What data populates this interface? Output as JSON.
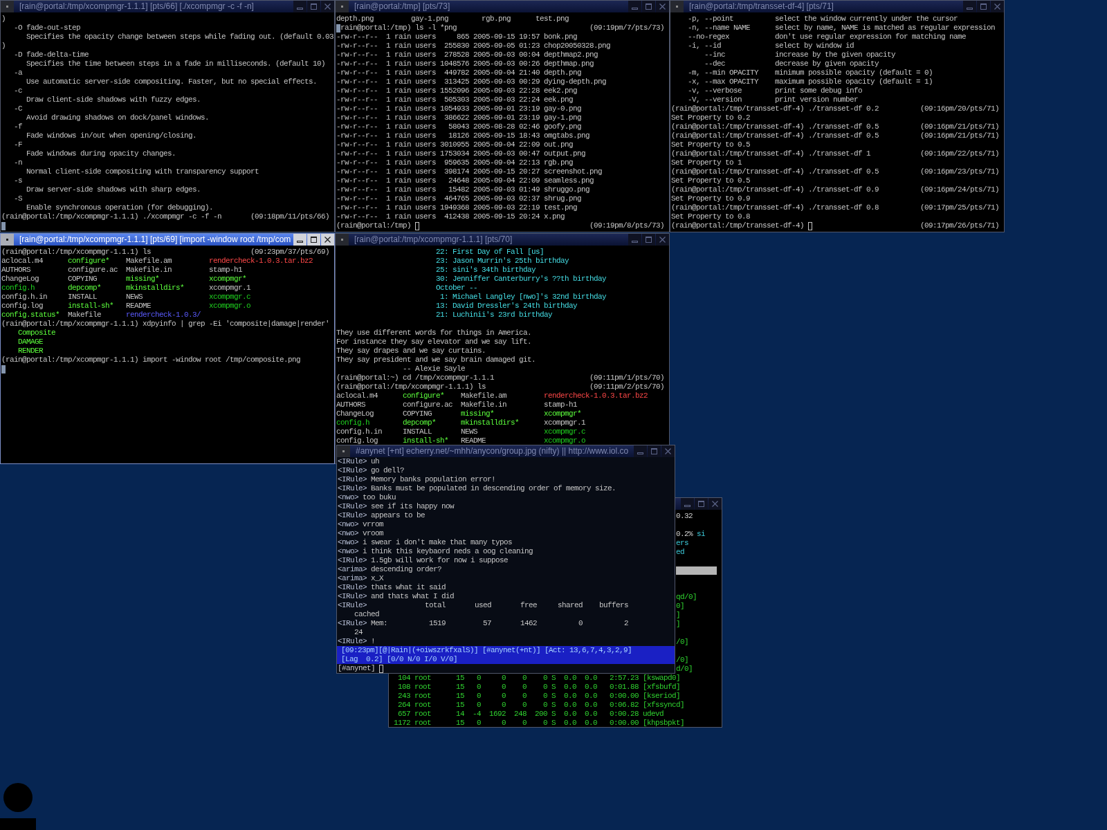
{
  "windows": [
    {
      "kind": "terminal",
      "title": "[rain@portal:/tmp/xcompmgr-1.1.1] [pts/66] [./xcompmgr -c -f -n]",
      "focused": false,
      "lines": [
        {
          "kind": "text",
          "text": ")"
        },
        {
          "kind": "option",
          "flag": "-O fade-out-step",
          "description": "Specifies the opacity change between steps while fading out. (default 0.03"
        },
        {
          "kind": "text",
          "text": ")"
        },
        {
          "kind": "option",
          "flag": "-D fade-delta-time",
          "description": "Specifies the time between steps in a fade in milliseconds. (default 10)"
        },
        {
          "kind": "option",
          "flag": "-a",
          "description": "Use automatic server-side compositing. Faster, but no special effects."
        },
        {
          "kind": "option",
          "flag": "-c",
          "description": "Draw client-side shadows with fuzzy edges."
        },
        {
          "kind": "option",
          "flag": "-C",
          "description": "Avoid drawing shadows on dock/panel windows."
        },
        {
          "kind": "option",
          "flag": "-f",
          "description": "Fade windows in/out when opening/closing."
        },
        {
          "kind": "option",
          "flag": "-F",
          "description": "Fade windows during opacity changes."
        },
        {
          "kind": "option",
          "flag": "-n",
          "description": "Normal client-side compositing with transparency support"
        },
        {
          "kind": "option",
          "flag": "-s",
          "description": "Draw server-side shadows with sharp edges."
        },
        {
          "kind": "option",
          "flag": "-S",
          "description": "Enable synchronous operation (for debugging)."
        },
        {
          "kind": "prompt",
          "text": "(rain@portal:/tmp/xcompmgr-1.1.1) ./xcompmgr -c -f -n",
          "stamp": "(09:18pm/11/pts/66)",
          "block_cursor": false,
          "cursor": false
        },
        {
          "kind": "cursor"
        }
      ]
    },
    {
      "kind": "terminal",
      "title": "[rain@portal:/tmp] [pts/73]",
      "focused": false,
      "lines": [
        {
          "kind": "listing",
          "rows": [
            [
              {
                "name": "depth.png",
                "kind": "file"
              },
              {
                "name": "gay-1.png",
                "kind": "file"
              },
              {
                "name": "rgb.png",
                "kind": "file"
              },
              {
                "name": "test.png",
                "kind": "file"
              }
            ]
          ]
        },
        {
          "kind": "prompt",
          "text": "rain@portal:/tmp) ls -l *png",
          "stamp": "(09:19pm/7/pts/73)",
          "block_cursor": true,
          "cursor": false
        },
        {
          "kind": "long_listing",
          "rows": [
            {
              "perms": "-rw-r--r--",
              "links": "1",
              "owner": "rain",
              "group": "users",
              "size": "865",
              "date": "2005-09-15",
              "time": "19:57",
              "name": "bonk.png"
            },
            {
              "perms": "-rw-r--r--",
              "links": "1",
              "owner": "rain",
              "group": "users",
              "size": "255830",
              "date": "2005-09-05",
              "time": "01:23",
              "name": "chop20050328.png"
            },
            {
              "perms": "-rw-r--r--",
              "links": "1",
              "owner": "rain",
              "group": "users",
              "size": "278528",
              "date": "2005-09-03",
              "time": "00:04",
              "name": "depthmap2.png"
            },
            {
              "perms": "-rw-r--r--",
              "links": "1",
              "owner": "rain",
              "group": "users",
              "size": "1048576",
              "date": "2005-09-03",
              "time": "00:26",
              "name": "depthmap.png"
            },
            {
              "perms": "-rw-r--r--",
              "links": "1",
              "owner": "rain",
              "group": "users",
              "size": "449782",
              "date": "2005-09-04",
              "time": "21:40",
              "name": "depth.png"
            },
            {
              "perms": "-rw-r--r--",
              "links": "1",
              "owner": "rain",
              "group": "users",
              "size": "313425",
              "date": "2005-09-03",
              "time": "00:29",
              "name": "dying-depth.png"
            },
            {
              "perms": "-rw-r--r--",
              "links": "1",
              "owner": "rain",
              "group": "users",
              "size": "1552096",
              "date": "2005-09-03",
              "time": "22:28",
              "name": "eek2.png"
            },
            {
              "perms": "-rw-r--r--",
              "links": "1",
              "owner": "rain",
              "group": "users",
              "size": "505303",
              "date": "2005-09-03",
              "time": "22:24",
              "name": "eek.png"
            },
            {
              "perms": "-rw-r--r--",
              "links": "1",
              "owner": "rain",
              "group": "users",
              "size": "1054933",
              "date": "2005-09-01",
              "time": "23:19",
              "name": "gay-0.png"
            },
            {
              "perms": "-rw-r--r--",
              "links": "1",
              "owner": "rain",
              "group": "users",
              "size": "386622",
              "date": "2005-09-01",
              "time": "23:19",
              "name": "gay-1.png"
            },
            {
              "perms": "-rw-r--r--",
              "links": "1",
              "owner": "rain",
              "group": "users",
              "size": "58043",
              "date": "2005-08-28",
              "time": "02:46",
              "name": "goofy.png"
            },
            {
              "perms": "-rw-r--r--",
              "links": "1",
              "owner": "rain",
              "group": "users",
              "size": "18126",
              "date": "2005-09-15",
              "time": "18:43",
              "name": "omgtabs.png"
            },
            {
              "perms": "-rw-r--r--",
              "links": "1",
              "owner": "rain",
              "group": "users",
              "size": "3010955",
              "date": "2005-09-04",
              "time": "22:09",
              "name": "out.png"
            },
            {
              "perms": "-rw-r--r--",
              "links": "1",
              "owner": "rain",
              "group": "users",
              "size": "1753034",
              "date": "2005-09-03",
              "time": "00:47",
              "name": "output.png"
            },
            {
              "perms": "-rw-r--r--",
              "links": "1",
              "owner": "rain",
              "group": "users",
              "size": "959635",
              "date": "2005-09-04",
              "time": "22:13",
              "name": "rgb.png"
            },
            {
              "perms": "-rw-r--r--",
              "links": "1",
              "owner": "rain",
              "group": "users",
              "size": "398174",
              "date": "2005-09-15",
              "time": "20:27",
              "name": "screenshot.png"
            },
            {
              "perms": "-rw-r--r--",
              "links": "1",
              "owner": "rain",
              "group": "users",
              "size": "24648",
              "date": "2005-09-04",
              "time": "22:09",
              "name": "seamless.png"
            },
            {
              "perms": "-rw-r--r--",
              "links": "1",
              "owner": "rain",
              "group": "users",
              "size": "15482",
              "date": "2005-09-03",
              "time": "01:49",
              "name": "shruggo.png"
            },
            {
              "perms": "-rw-r--r--",
              "links": "1",
              "owner": "rain",
              "group": "users",
              "size": "464765",
              "date": "2005-09-03",
              "time": "02:37",
              "name": "shrug.png"
            },
            {
              "perms": "-rw-r--r--",
              "links": "1",
              "owner": "rain",
              "group": "users",
              "size": "1949368",
              "date": "2005-09-03",
              "time": "22:19",
              "name": "test.png"
            },
            {
              "perms": "-rw-r--r--",
              "links": "1",
              "owner": "rain",
              "group": "users",
              "size": "412438",
              "date": "2005-09-15",
              "time": "20:24",
              "name": "x.png"
            }
          ]
        },
        {
          "kind": "prompt",
          "text": "(rain@portal:/tmp)",
          "stamp": "(09:19pm/8/pts/73)",
          "block_cursor": false,
          "cursor": true
        }
      ]
    },
    {
      "kind": "terminal",
      "title": "[rain@portal:/tmp/transset-df-4] [pts/71]",
      "focused": false,
      "lines": [
        {
          "kind": "option_row",
          "flag": "-p, --point",
          "description": "select the window currently under the cursor"
        },
        {
          "kind": "option_row",
          "flag": "-n, --name NAME",
          "description": "select by name, NAME is matched as regular expression"
        },
        {
          "kind": "option_row",
          "flag": "--no-regex",
          "description": "don't use regular expression for matching name"
        },
        {
          "kind": "option_row",
          "flag": "-i, --id",
          "description": "select by window id",
          "children": [
            {
              "flag": "--inc",
              "description": "increase by the given opacity"
            },
            {
              "flag": "--dec",
              "description": "decrease by given opacity"
            }
          ]
        },
        {
          "kind": "option_row",
          "flag": "-m, --min OPACITY",
          "description": "minimum possible opacity (default = 0)"
        },
        {
          "kind": "option_row",
          "flag": "-x, --max OPACITY",
          "description": "maximum possible opacity (default = 1)"
        },
        {
          "kind": "option_row",
          "flag": "-v, --verbose",
          "description": "print some debug info"
        },
        {
          "kind": "option_row",
          "flag": "-V, --version",
          "description": "print version number"
        },
        {
          "kind": "prompt",
          "text": "(rain@portal:/tmp/transset-df-4) ./transset-df 0.2",
          "stamp": "(09:16pm/20/pts/71)",
          "block_cursor": false,
          "cursor": false
        },
        {
          "kind": "text",
          "text": "Set Property to 0.2"
        },
        {
          "kind": "prompt",
          "text": "(rain@portal:/tmp/transset-df-4) ./transset-df 0.5",
          "stamp": "(09:16pm/21/pts/71)",
          "block_cursor": false,
          "cursor": false
        },
        {
          "kind": "prompt",
          "text": "(rain@portal:/tmp/transset-df-4) ./transset-df 0.5",
          "stamp": "(09:16pm/21/pts/71)",
          "block_cursor": false,
          "cursor": false
        },
        {
          "kind": "text",
          "text": "Set Property to 0.5"
        },
        {
          "kind": "prompt",
          "text": "(rain@portal:/tmp/transset-df-4) ./transset-df 1",
          "stamp": "(09:16pm/22/pts/71)",
          "block_cursor": false,
          "cursor": false
        },
        {
          "kind": "text",
          "text": "Set Property to 1"
        },
        {
          "kind": "prompt",
          "text": "(rain@portal:/tmp/transset-df-4) ./transset-df 0.5",
          "stamp": "(09:16pm/23/pts/71)",
          "block_cursor": false,
          "cursor": false
        },
        {
          "kind": "text",
          "text": "Set Property to 0.5"
        },
        {
          "kind": "prompt",
          "text": "(rain@portal:/tmp/transset-df-4) ./transset-df 0.9",
          "stamp": "(09:16pm/24/pts/71)",
          "block_cursor": false,
          "cursor": false
        },
        {
          "kind": "text",
          "text": "Set Property to 0.9"
        },
        {
          "kind": "prompt",
          "text": "(rain@portal:/tmp/transset-df-4) ./transset-df 0.8",
          "stamp": "(09:17pm/25/pts/71)",
          "block_cursor": false,
          "cursor": false
        },
        {
          "kind": "text",
          "text": "Set Property to 0.8"
        },
        {
          "kind": "prompt",
          "text": "(rain@portal:/tmp/transset-df-4)",
          "stamp": "(09:17pm/26/pts/71)",
          "block_cursor": false,
          "cursor": true
        }
      ]
    },
    {
      "kind": "terminal",
      "title": "[rain@portal:/tmp/xcompmgr-1.1.1] [pts/69] [import -window root /tmp/com",
      "focused": true,
      "lines": [
        {
          "kind": "prompt",
          "text": "(rain@portal:/tmp/xcompmgr-1.1.1) ls",
          "stamp": "(09:23pm/37/pts/69)",
          "block_cursor": false,
          "cursor": false
        },
        {
          "kind": "listing",
          "rows": [
            [
              {
                "name": "aclocal.m4",
                "kind": "file"
              },
              {
                "name": "configure*",
                "kind": "executable"
              },
              {
                "name": "Makefile.am",
                "kind": "file"
              },
              {
                "name": "rendercheck-1.0.3.tar.bz2",
                "kind": "archive"
              }
            ],
            [
              {
                "name": "AUTHORS",
                "kind": "file"
              },
              {
                "name": "configure.ac",
                "kind": "file"
              },
              {
                "name": "Makefile.in",
                "kind": "file"
              },
              {
                "name": "stamp-h1",
                "kind": "file"
              }
            ],
            [
              {
                "name": "ChangeLog",
                "kind": "file"
              },
              {
                "name": "COPYING",
                "kind": "file"
              },
              {
                "name": "missing*",
                "kind": "executable"
              },
              {
                "name": "xcompmgr*",
                "kind": "executable"
              }
            ],
            [
              {
                "name": "config.h",
                "kind": "source"
              },
              {
                "name": "depcomp*",
                "kind": "executable"
              },
              {
                "name": "mkinstalldirs*",
                "kind": "executable"
              },
              {
                "name": "xcompmgr.1",
                "kind": "file"
              }
            ],
            [
              {
                "name": "config.h.in",
                "kind": "file"
              },
              {
                "name": "INSTALL",
                "kind": "file"
              },
              {
                "name": "NEWS",
                "kind": "file"
              },
              {
                "name": "xcompmgr.c",
                "kind": "source"
              }
            ],
            [
              {
                "name": "config.log",
                "kind": "file"
              },
              {
                "name": "install-sh*",
                "kind": "executable"
              },
              {
                "name": "README",
                "kind": "file"
              },
              {
                "name": "xcompmgr.o",
                "kind": "source"
              }
            ],
            [
              {
                "name": "config.status*",
                "kind": "executable"
              },
              {
                "name": "Makefile",
                "kind": "file"
              },
              {
                "name": "rendercheck-1.0.3/",
                "kind": "directory"
              }
            ]
          ]
        },
        {
          "kind": "prompt",
          "text": "(rain@portal:/tmp/xcompmgr-1.1.1) xdpyinfo | grep -Ei 'composite|damage|render'",
          "block_cursor": false,
          "cursor": false
        },
        {
          "kind": "match",
          "text": "Composite"
        },
        {
          "kind": "match",
          "text": "DAMAGE"
        },
        {
          "kind": "match",
          "text": "RENDER"
        },
        {
          "kind": "prompt",
          "text": "(rain@portal:/tmp/xcompmgr-1.1.1) import -window root /tmp/composite.png",
          "block_cursor": false,
          "cursor": false
        },
        {
          "kind": "cursor"
        }
      ]
    },
    {
      "kind": "terminal",
      "title": "[rain@portal:/tmp/xcompmgr-1.1.1] [pts/70]",
      "focused": false,
      "lines": [
        {
          "kind": "calendar",
          "day": "22:",
          "event": "First Day of Fall [us]"
        },
        {
          "kind": "calendar",
          "day": "23:",
          "event": "Jason Murrin's 25th birthday"
        },
        {
          "kind": "calendar",
          "day": "25:",
          "event": "sini's 34th birthday"
        },
        {
          "kind": "calendar",
          "day": "30:",
          "event": "Jenniffer Canterburry's ??th birthday"
        },
        {
          "kind": "month",
          "text": "October --"
        },
        {
          "kind": "calendar",
          "day": "1:",
          "event": "Michael Langley [nwo]'s 32nd birthday"
        },
        {
          "kind": "calendar",
          "day": "13:",
          "event": "David Dressler's 24th birthday"
        },
        {
          "kind": "calendar",
          "day": "21:",
          "event": "Luchinii's 23rd birthday"
        },
        {
          "kind": "blank"
        },
        {
          "kind": "quote",
          "text": "They use different words for things in America."
        },
        {
          "kind": "quote",
          "text": "For instance they say elevator and we say lift."
        },
        {
          "kind": "quote",
          "text": "They say drapes and we say curtains."
        },
        {
          "kind": "quote",
          "text": "They say president and we say brain damaged git."
        },
        {
          "kind": "attribution",
          "text": "-- Alexie Sayle"
        },
        {
          "kind": "prompt",
          "text": "(rain@portal:~) cd /tmp/xcompmgr-1.1.1",
          "stamp": "(09:11pm/1/pts/70)",
          "block_cursor": false,
          "cursor": false
        },
        {
          "kind": "prompt",
          "text": "(rain@portal:/tmp/xcompmgr-1.1.1) ls",
          "stamp": "(09:11pm/2/pts/70)",
          "block_cursor": false,
          "cursor": false
        },
        {
          "kind": "listing",
          "rows": [
            [
              {
                "name": "aclocal.m4",
                "kind": "file"
              },
              {
                "name": "configure*",
                "kind": "executable"
              },
              {
                "name": "Makefile.am",
                "kind": "file"
              },
              {
                "name": "rendercheck-1.0.3.tar.bz2",
                "kind": "archive"
              }
            ],
            [
              {
                "name": "AUTHORS",
                "kind": "file"
              },
              {
                "name": "configure.ac",
                "kind": "file"
              },
              {
                "name": "Makefile.in",
                "kind": "file"
              },
              {
                "name": "stamp-h1",
                "kind": "file"
              }
            ],
            [
              {
                "name": "ChangeLog",
                "kind": "file"
              },
              {
                "name": "COPYING",
                "kind": "file"
              },
              {
                "name": "missing*",
                "kind": "executable"
              },
              {
                "name": "xcompmgr*",
                "kind": "executable"
              }
            ],
            [
              {
                "name": "config.h",
                "kind": "source"
              },
              {
                "name": "depcomp*",
                "kind": "executable"
              },
              {
                "name": "mkinstalldirs*",
                "kind": "executable"
              },
              {
                "name": "xcompmgr.1",
                "kind": "file"
              }
            ],
            [
              {
                "name": "config.h.in",
                "kind": "file"
              },
              {
                "name": "INSTALL",
                "kind": "file"
              },
              {
                "name": "NEWS",
                "kind": "file"
              },
              {
                "name": "xcompmgr.c",
                "kind": "source"
              }
            ],
            [
              {
                "name": "config.log",
                "kind": "file"
              },
              {
                "name": "install-sh*",
                "kind": "executable"
              },
              {
                "name": "README",
                "kind": "file"
              },
              {
                "name": "xcompmgr.o",
                "kind": "source"
              }
            ]
          ]
        }
      ]
    },
    {
      "kind": "irc",
      "title": "#anynet [+nt] echerry.net/~mhh/anycon/group.jpg (nifty) || http://www.iol.co",
      "focused": false,
      "messages": [
        {
          "kind": "message",
          "nick": "<IRule>",
          "text": "uh"
        },
        {
          "kind": "message",
          "nick": "<IRule>",
          "text": "go dell?"
        },
        {
          "kind": "message",
          "nick": "<IRule>",
          "text": "Memory banks population error!"
        },
        {
          "kind": "message",
          "nick": "<IRule>",
          "text": "Banks must be populated in descending order of memory size."
        },
        {
          "kind": "message",
          "nick": "<nwo>",
          "text": "too buku"
        },
        {
          "kind": "message",
          "nick": "<IRule>",
          "text": "see if its happy now"
        },
        {
          "kind": "message",
          "nick": "<IRule>",
          "text": "appears to be"
        },
        {
          "kind": "message",
          "nick": "<nwo>",
          "text": "vrrom"
        },
        {
          "kind": "message",
          "nick": "<nwo>",
          "text": "vroom"
        },
        {
          "kind": "message",
          "nick": "<nwo>",
          "text": "i swear i don't make that many typos"
        },
        {
          "kind": "message",
          "nick": "<nwo>",
          "text": "i think this keybaord neds a oog cleaning"
        },
        {
          "kind": "message",
          "nick": "<IRule>",
          "text": "1.5gb will work for now i suppose"
        },
        {
          "kind": "message",
          "nick": "<arima>",
          "text": "descending order?"
        },
        {
          "kind": "message",
          "nick": "<arima>",
          "text": "x_X"
        },
        {
          "kind": "message",
          "nick": "<IRule>",
          "text": "thats what it said"
        },
        {
          "kind": "message",
          "nick": "<IRule>",
          "text": "and thats what I did"
        },
        {
          "kind": "table_header",
          "nick": "<IRule>",
          "cells": [
            "total",
            "used",
            "free",
            "shared",
            "buffers"
          ],
          "overflow": "cached"
        },
        {
          "kind": "table_row",
          "nick": "<IRule>",
          "label": "Mem:",
          "cells": [
            "1519",
            "57",
            "1462",
            "0",
            "2"
          ],
          "overflow": "24"
        },
        {
          "kind": "message",
          "nick": "<IRule>",
          "text": "!"
        }
      ],
      "status_bar": {
        "lines": [
          {
            "items": [
              "[09:23pm][@|Rain|(+oiwszrkfxalS)]",
              "[#anynet(+nt)]",
              "[Act: 13,6,7,4,3,2,9]"
            ]
          },
          {
            "items": [
              "[Lag  0.2]",
              "[0/0 N/0 I/0 V/0]"
            ]
          }
        ]
      },
      "input": {
        "prompt": "[#anynet]"
      }
    },
    {
      "kind": "top",
      "focused": false,
      "lines": [
        {
          "kind": "value",
          "text": "0.32"
        },
        {
          "kind": "blank"
        },
        {
          "kind": "stat",
          "value": "0.2%",
          "label": "si"
        },
        {
          "kind": "label",
          "text": "ers"
        },
        {
          "kind": "label",
          "text": "ed"
        },
        {
          "kind": "blank"
        },
        {
          "kind": "header"
        },
        {
          "kind": "blank"
        },
        {
          "kind": "blank"
        },
        {
          "kind": "command",
          "text": "qd/0]"
        },
        {
          "kind": "command",
          "text": "0]"
        },
        {
          "kind": "command",
          "text": "]"
        },
        {
          "kind": "command",
          "text": "]"
        },
        {
          "kind": "blank"
        },
        {
          "kind": "command",
          "text": "/0]"
        },
        {
          "kind": "blank"
        },
        {
          "kind": "command",
          "text": "/0]"
        },
        {
          "kind": "command",
          "text": "d/0]"
        },
        {
          "kind": "process",
          "pid": "104",
          "user": "root",
          "pr": "15",
          "ni": "0",
          "virt": "0",
          "res": "0",
          "shr": "0",
          "state": "S",
          "cpu": "0.0",
          "mem": "0.0",
          "time": "2:57.23",
          "command": "[kswapd0]"
        },
        {
          "kind": "process",
          "pid": "108",
          "user": "root",
          "pr": "15",
          "ni": "0",
          "virt": "0",
          "res": "0",
          "shr": "0",
          "state": "S",
          "cpu": "0.0",
          "mem": "0.0",
          "time": "0:01.88",
          "command": "[xfsbufd]"
        },
        {
          "kind": "process",
          "pid": "243",
          "user": "root",
          "pr": "15",
          "ni": "0",
          "virt": "0",
          "res": "0",
          "shr": "0",
          "state": "S",
          "cpu": "0.0",
          "mem": "0.0",
          "time": "0:00.00",
          "command": "[kseriod]"
        },
        {
          "kind": "process",
          "pid": "264",
          "user": "root",
          "pr": "15",
          "ni": "0",
          "virt": "0",
          "res": "0",
          "shr": "0",
          "state": "S",
          "cpu": "0.0",
          "mem": "0.0",
          "time": "0:06.82",
          "command": "[xfssyncd]"
        },
        {
          "kind": "process",
          "pid": "657",
          "user": "root",
          "pr": "14",
          "ni": "-4",
          "virt": "1692",
          "res": "248",
          "shr": "200",
          "state": "S",
          "cpu": "0.0",
          "mem": "0.0",
          "time": "0:00.28",
          "command": "udevd"
        },
        {
          "kind": "process",
          "pid": "1172",
          "user": "root",
          "pr": "15",
          "ni": "0",
          "virt": "0",
          "res": "0",
          "shr": "0",
          "state": "S",
          "cpu": "0.0",
          "mem": "0.0",
          "time": "0:00.00",
          "command": "[khpsbpkt]"
        }
      ]
    }
  ]
}
